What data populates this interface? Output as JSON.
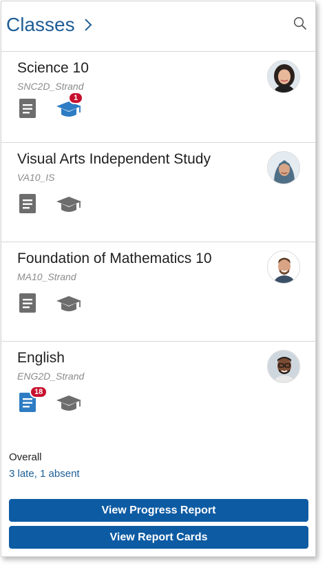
{
  "header": {
    "title": "Classes"
  },
  "colors": {
    "accent": "#1d5d95",
    "button": "#0d5ba3",
    "badge": "#c8102e",
    "icon_gray": "#6d6d6d",
    "icon_active": "#2d7cc4"
  },
  "classes": [
    {
      "name": "Science 10",
      "code": "SNC2D_Strand",
      "cap_badge": "1",
      "doc_badge": null
    },
    {
      "name": "Visual Arts Independent Study",
      "code": "VA10_IS",
      "cap_badge": null,
      "doc_badge": null
    },
    {
      "name": "Foundation of Mathematics 10",
      "code": "MA10_Strand",
      "cap_badge": null,
      "doc_badge": null
    },
    {
      "name": "English",
      "code": "ENG2D_Strand",
      "cap_badge": null,
      "doc_badge": "18"
    }
  ],
  "overall": {
    "label": "Overall",
    "value": "3 late, 1 absent"
  },
  "buttons": {
    "progress": "View Progress Report",
    "report_cards": "View Report Cards"
  }
}
